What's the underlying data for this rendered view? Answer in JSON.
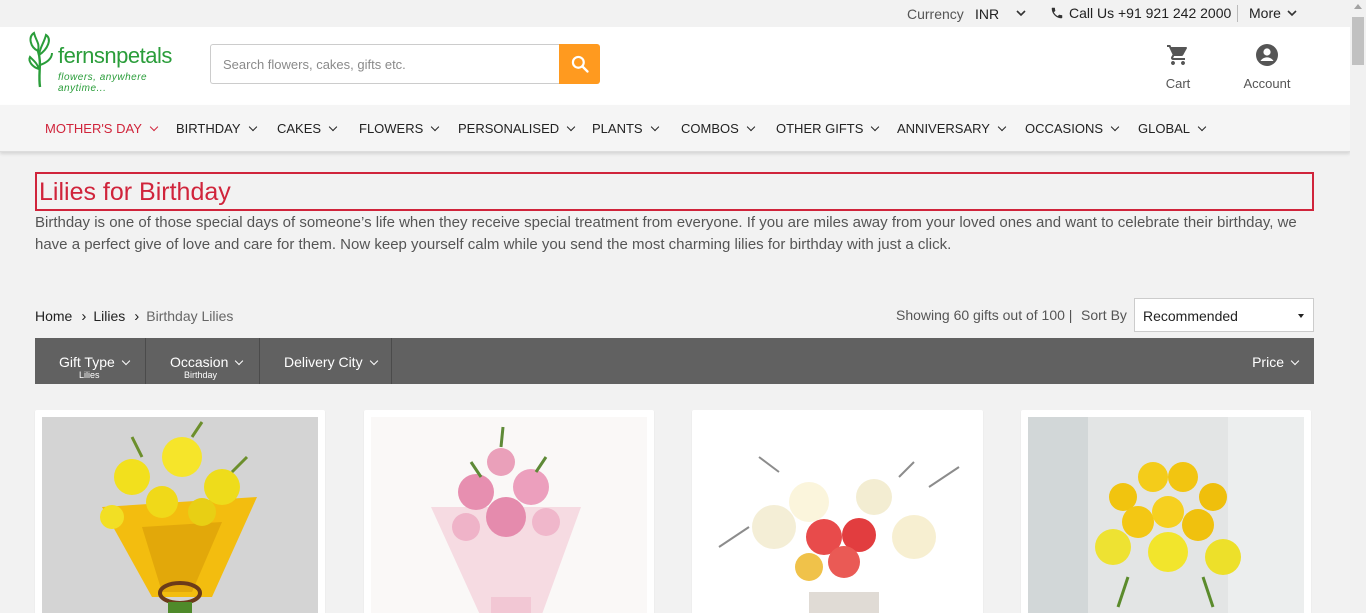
{
  "topbar": {
    "currency_label": "Currency",
    "currency_value": "INR",
    "call_text": "Call Us +91 921 242 2000",
    "more_label": "More"
  },
  "header": {
    "logo_word": "fernsnpetals",
    "logo_tagline": "flowers, anywhere anytime...",
    "search_placeholder": "Search flowers, cakes, gifts etc.",
    "cart_label": "Cart",
    "account_label": "Account"
  },
  "nav": {
    "items": [
      {
        "label": "MOTHER'S DAY"
      },
      {
        "label": "BIRTHDAY"
      },
      {
        "label": "CAKES"
      },
      {
        "label": "FLOWERS"
      },
      {
        "label": "PERSONALISED"
      },
      {
        "label": "PLANTS"
      },
      {
        "label": "COMBOS"
      },
      {
        "label": "OTHER GIFTS"
      },
      {
        "label": "ANNIVERSARY"
      },
      {
        "label": "OCCASIONS"
      },
      {
        "label": "GLOBAL"
      }
    ]
  },
  "page": {
    "title": "Lilies for Birthday",
    "description": "Birthday is one of those special days of someone’s life when they receive special treatment from everyone. If you are miles away from your loved ones and want to celebrate their birthday, we have a perfect give of love and care for them. Now keep yourself calm while you send the most charming lilies for birthday with just a click."
  },
  "breadcrumb": [
    "Home",
    "Lilies",
    "Birthday Lilies"
  ],
  "listing": {
    "showing_text": "Showing 60 gifts out of 100 |",
    "sort_label": "Sort By",
    "sort_value": "Recommended"
  },
  "filters": {
    "gift_type": {
      "label": "Gift Type",
      "value": "Lilies"
    },
    "occasion": {
      "label": "Occasion",
      "value": "Birthday"
    },
    "delivery_city": {
      "label": "Delivery City"
    },
    "price": {
      "label": "Price"
    }
  },
  "colors": {
    "accent_red": "#d0243b",
    "search_orange": "#ff9a1f",
    "filter_bar": "#616161",
    "brand_green": "#2a9d3a"
  }
}
